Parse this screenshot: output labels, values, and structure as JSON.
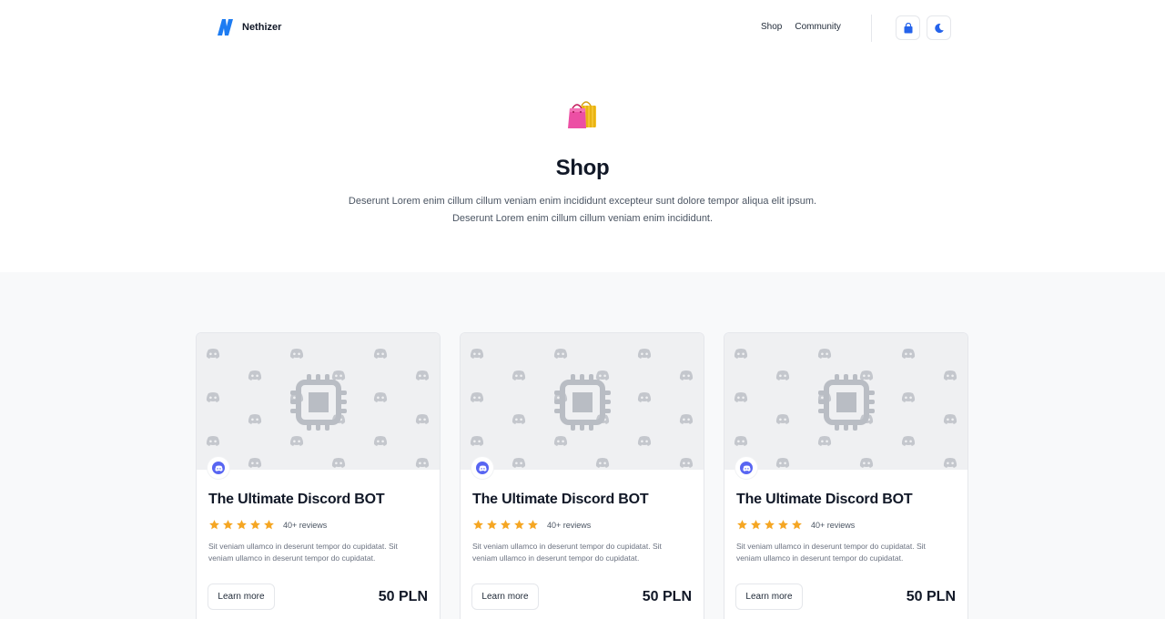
{
  "brand": {
    "name": "Nethizer",
    "logo_icon": "lightning-n-logo",
    "accent": "#1d7cf2"
  },
  "nav": {
    "items": [
      {
        "label": "Shop"
      },
      {
        "label": "Community"
      }
    ]
  },
  "header_buttons": [
    {
      "icon": "shopping-bag-icon",
      "color": "#2563eb"
    },
    {
      "icon": "moon-icon",
      "color": "#2563eb"
    }
  ],
  "hero": {
    "emoji": "shopping-bags-icon",
    "title": "Shop",
    "description_line1": "Deserunt Lorem enim cillum cillum veniam enim incididunt excepteur sunt dolore tempor aliqua elit ipsum.",
    "description_line2": "Deserunt Lorem enim cillum cillum veniam enim incididunt."
  },
  "products": [
    {
      "title": "The Ultimate Discord BOT",
      "rating": 5,
      "reviews": "40+ reviews",
      "description": "Sit veniam ullamco in deserunt tempor do cupidatat. Sit veniam ullamco in deserunt tempor do cupidatat.",
      "button": "Learn more",
      "price": "50 PLN",
      "platform_icon": "discord-icon"
    },
    {
      "title": "The Ultimate Discord BOT",
      "rating": 5,
      "reviews": "40+ reviews",
      "description": "Sit veniam ullamco in deserunt tempor do cupidatat. Sit veniam ullamco in deserunt tempor do cupidatat.",
      "button": "Learn more",
      "price": "50 PLN",
      "platform_icon": "discord-icon"
    },
    {
      "title": "The Ultimate Discord BOT",
      "rating": 5,
      "reviews": "40+ reviews",
      "description": "Sit veniam ullamco in deserunt tempor do cupidatat. Sit veniam ullamco in deserunt tempor do cupidatat.",
      "button": "Learn more",
      "price": "50 PLN",
      "platform_icon": "discord-icon"
    }
  ],
  "colors": {
    "star": "#f5a623",
    "discord": "#5865f2",
    "section_bg": "#f8f9fa"
  }
}
